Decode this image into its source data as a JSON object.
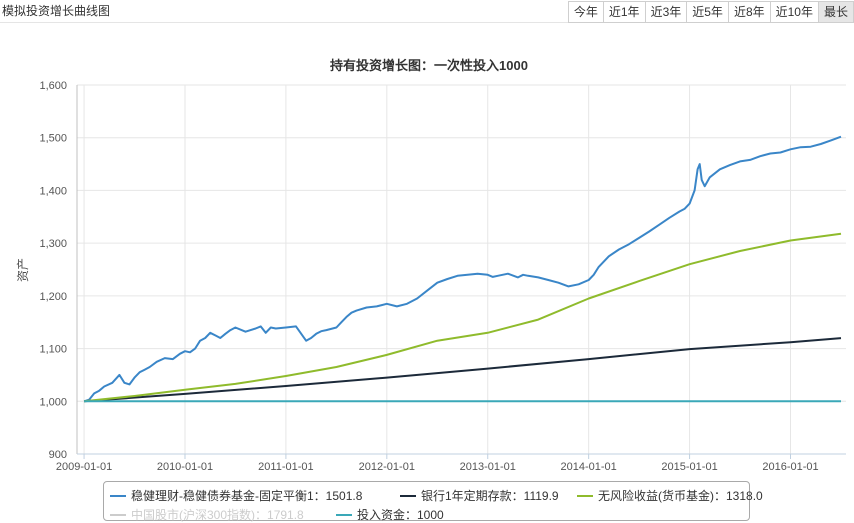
{
  "panel_title": "模拟投资增长曲线图",
  "range_tabs": [
    {
      "label": "今年",
      "active": false
    },
    {
      "label": "近1年",
      "active": false
    },
    {
      "label": "近3年",
      "active": false
    },
    {
      "label": "近5年",
      "active": false
    },
    {
      "label": "近8年",
      "active": false
    },
    {
      "label": "近10年",
      "active": false
    },
    {
      "label": "最长",
      "active": true
    }
  ],
  "legend": [
    {
      "text": "稳健理财-稳健债券基金-固定平衡1：1501.8",
      "color": "#3a86c8",
      "hidden": false
    },
    {
      "text": "银行1年定期存款：1119.9",
      "color": "#1c2a3a",
      "hidden": false
    },
    {
      "text": "无风险收益(货币基金)：1318.0",
      "color": "#8fbb2c",
      "hidden": false
    },
    {
      "text": "中国股市(沪深300指数)：1791.8",
      "color": "#cccccc",
      "hidden": true
    },
    {
      "text": "投入资金：1000",
      "color": "#3aa8b8",
      "hidden": false
    }
  ],
  "chart_data": {
    "type": "line",
    "title": "持有投资增长图：一次性投入1000",
    "ylabel": "资产",
    "xlabel": "",
    "ylim": [
      900,
      1600
    ],
    "yticks": [
      900,
      1000,
      1100,
      1200,
      1300,
      1400,
      1500,
      1600
    ],
    "ytick_labels": [
      "900",
      "1,000",
      "1,100",
      "1,200",
      "1,300",
      "1,400",
      "1,500",
      "1,600"
    ],
    "xlim": [
      2008.93,
      2016.55
    ],
    "xticks": [
      2009,
      2010,
      2011,
      2012,
      2013,
      2014,
      2015,
      2016
    ],
    "xtick_labels": [
      "2009-01-01",
      "2010-01-01",
      "2011-01-01",
      "2012-01-01",
      "2013-01-01",
      "2014-01-01",
      "2015-01-01",
      "2016-01-01"
    ],
    "grid": true,
    "legend_position": "bottom",
    "series": [
      {
        "name": "稳健理财-稳健债券基金-固定平衡1",
        "color": "#3a86c8",
        "x": [
          2009.0,
          2009.05,
          2009.1,
          2009.15,
          2009.2,
          2009.28,
          2009.35,
          2009.4,
          2009.45,
          2009.5,
          2009.55,
          2009.6,
          2009.65,
          2009.72,
          2009.8,
          2009.88,
          2009.95,
          2010.0,
          2010.05,
          2010.1,
          2010.15,
          2010.2,
          2010.25,
          2010.3,
          2010.35,
          2010.4,
          2010.45,
          2010.5,
          2010.6,
          2010.7,
          2010.75,
          2010.8,
          2010.85,
          2010.9,
          2011.0,
          2011.1,
          2011.2,
          2011.25,
          2011.3,
          2011.35,
          2011.4,
          2011.5,
          2011.55,
          2011.6,
          2011.65,
          2011.7,
          2011.8,
          2011.9,
          2012.0,
          2012.1,
          2012.2,
          2012.3,
          2012.4,
          2012.5,
          2012.6,
          2012.7,
          2012.8,
          2012.9,
          2013.0,
          2013.05,
          2013.1,
          2013.2,
          2013.3,
          2013.35,
          2013.4,
          2013.5,
          2013.6,
          2013.7,
          2013.8,
          2013.9,
          2014.0,
          2014.05,
          2014.1,
          2014.2,
          2014.3,
          2014.4,
          2014.5,
          2014.6,
          2014.7,
          2014.8,
          2014.9,
          2014.95,
          2015.0,
          2015.05,
          2015.08,
          2015.1,
          2015.12,
          2015.15,
          2015.2,
          2015.3,
          2015.4,
          2015.5,
          2015.6,
          2015.7,
          2015.8,
          2015.9,
          2016.0,
          2016.1,
          2016.2,
          2016.3,
          2016.4,
          2016.5
        ],
        "y": [
          1000,
          1003,
          1015,
          1020,
          1028,
          1035,
          1050,
          1035,
          1032,
          1045,
          1055,
          1060,
          1065,
          1075,
          1082,
          1080,
          1090,
          1095,
          1093,
          1100,
          1115,
          1120,
          1130,
          1125,
          1120,
          1128,
          1135,
          1140,
          1132,
          1138,
          1142,
          1130,
          1140,
          1138,
          1140,
          1142,
          1115,
          1120,
          1128,
          1133,
          1135,
          1140,
          1150,
          1160,
          1168,
          1172,
          1178,
          1180,
          1185,
          1180,
          1185,
          1195,
          1210,
          1225,
          1232,
          1238,
          1240,
          1242,
          1240,
          1236,
          1238,
          1242,
          1235,
          1240,
          1238,
          1235,
          1230,
          1225,
          1218,
          1222,
          1230,
          1240,
          1255,
          1275,
          1288,
          1298,
          1310,
          1322,
          1335,
          1348,
          1360,
          1365,
          1375,
          1400,
          1440,
          1450,
          1420,
          1408,
          1425,
          1440,
          1448,
          1455,
          1458,
          1465,
          1470,
          1472,
          1478,
          1482,
          1483,
          1488,
          1495,
          1502
        ]
      },
      {
        "name": "银行1年定期存款",
        "color": "#1c2a3a",
        "x": [
          2009.0,
          2010.0,
          2011.0,
          2012.0,
          2013.0,
          2014.0,
          2015.0,
          2016.0,
          2016.5
        ],
        "y": [
          1000,
          1014,
          1029,
          1045,
          1062,
          1080,
          1099,
          1112,
          1119.9
        ]
      },
      {
        "name": "无风险收益(货币基金)",
        "color": "#8fbb2c",
        "x": [
          2009.0,
          2009.5,
          2010.0,
          2010.5,
          2011.0,
          2011.5,
          2012.0,
          2012.5,
          2013.0,
          2013.5,
          2014.0,
          2014.5,
          2015.0,
          2015.5,
          2016.0,
          2016.5
        ],
        "y": [
          1000,
          1010,
          1022,
          1033,
          1048,
          1065,
          1088,
          1115,
          1130,
          1155,
          1195,
          1228,
          1260,
          1285,
          1305,
          1318
        ]
      },
      {
        "name": "投入资金",
        "color": "#3aa8b8",
        "x": [
          2009.0,
          2016.5
        ],
        "y": [
          1000,
          1000
        ]
      }
    ]
  }
}
